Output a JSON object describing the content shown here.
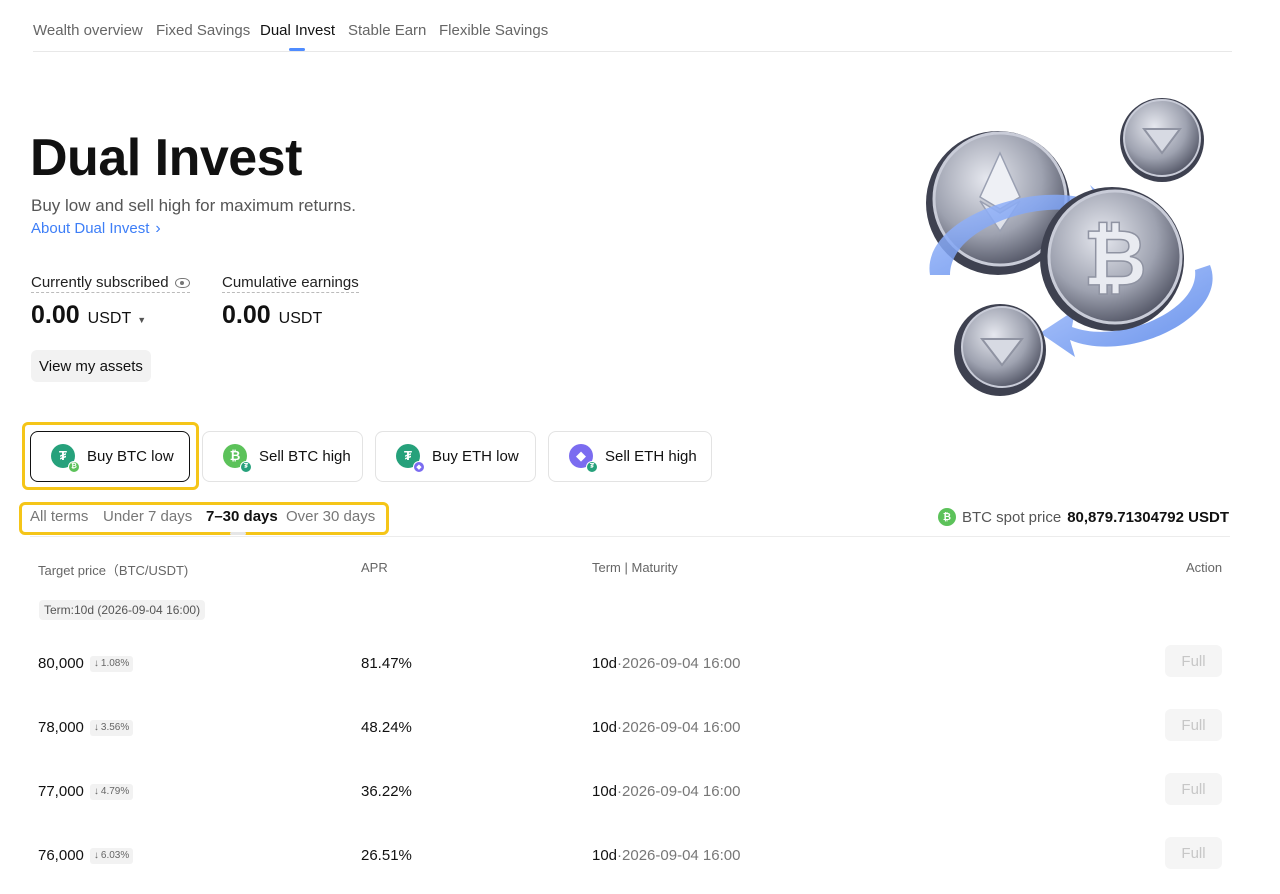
{
  "nav": {
    "tabs": [
      {
        "label": "Wealth overview"
      },
      {
        "label": "Fixed Savings"
      },
      {
        "label": "Dual Invest"
      },
      {
        "label": "Stable Earn"
      },
      {
        "label": "Flexible Savings"
      }
    ],
    "active_tab": "Dual Invest"
  },
  "hero": {
    "title": "Dual Invest",
    "subtitle": "Buy low and sell high for maximum returns.",
    "about_link": "About Dual Invest",
    "currently_subscribed": {
      "label": "Currently subscribed",
      "value": "0.00",
      "unit": "USDT"
    },
    "cumulative_earnings": {
      "label": "Cumulative earnings",
      "value": "0.00",
      "unit": "USDT"
    },
    "view_assets_label": "View my assets"
  },
  "products": [
    {
      "label": "Buy BTC low",
      "icon": "usdt-btc-icon",
      "active": true
    },
    {
      "label": "Sell BTC high",
      "icon": "btc-usdt-icon",
      "active": false
    },
    {
      "label": "Buy ETH low",
      "icon": "usdt-eth-icon",
      "active": false
    },
    {
      "label": "Sell ETH high",
      "icon": "eth-usdt-icon",
      "active": false
    }
  ],
  "terms": {
    "options": [
      "All terms",
      "Under 7 days",
      "7–30 days",
      "Over 30 days"
    ],
    "selected": "7–30 days"
  },
  "spot": {
    "label": "BTC spot price",
    "price": "80,879.71304792 USDT"
  },
  "table": {
    "headers": {
      "target_price": "Target price（BTC/USDT)",
      "apr": "APR",
      "term": "Term | Maturity",
      "action": "Action"
    },
    "group_tag": "Term:10d (2026-09-04 16:00)",
    "rows": [
      {
        "price": "80,000",
        "pct": "1.08%",
        "apr": "81.47%",
        "term": "10d",
        "maturity": "2026-09-04 16:00",
        "action": "Full"
      },
      {
        "price": "78,000",
        "pct": "3.56%",
        "apr": "48.24%",
        "term": "10d",
        "maturity": "2026-09-04 16:00",
        "action": "Full"
      },
      {
        "price": "77,000",
        "pct": "4.79%",
        "apr": "36.22%",
        "term": "10d",
        "maturity": "2026-09-04 16:00",
        "action": "Full"
      },
      {
        "price": "76,000",
        "pct": "6.03%",
        "apr": "26.51%",
        "term": "10d",
        "maturity": "2026-09-04 16:00",
        "action": "Full"
      }
    ]
  },
  "colors": {
    "accent": "#4f8cff",
    "link": "#3d7ef7",
    "highlight": "#f5c518",
    "usdt": "#26a17b",
    "btc_green": "#5cc25a",
    "eth": "#7b6cf0"
  }
}
